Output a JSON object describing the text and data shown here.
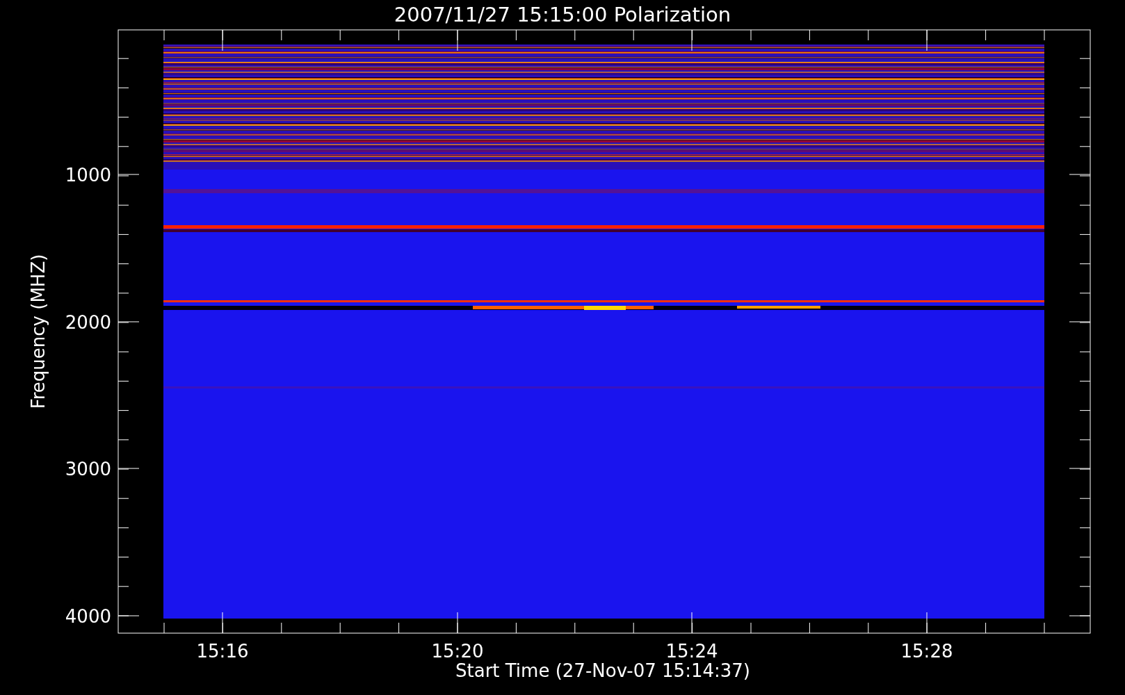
{
  "title": "2007/11/27 15:15:00 Polarization",
  "y_axis": {
    "label": "Frequency (MHZ)",
    "tick_labels": [
      "1000",
      "2000",
      "3000",
      "4000"
    ]
  },
  "x_axis": {
    "label": "Start Time (27-Nov-07 15:14:37)",
    "tick_labels": [
      "15:16",
      "15:20",
      "15:24",
      "15:28"
    ]
  }
}
